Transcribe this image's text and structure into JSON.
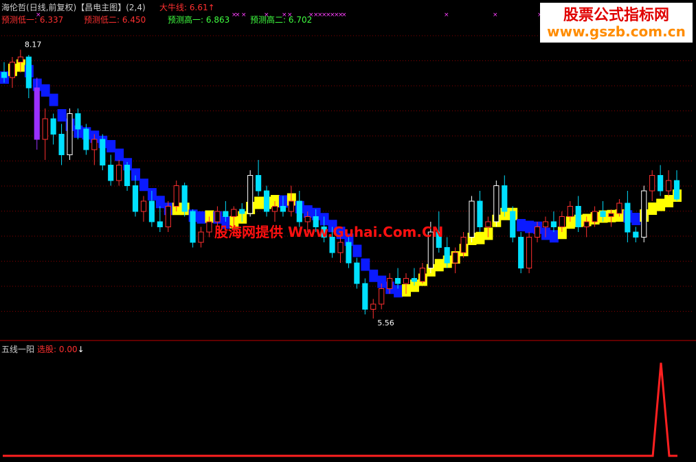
{
  "header": {
    "stock_name": "海伦哲",
    "period": "(日线,前复权)",
    "indicator": "【昌电主图】",
    "params": "(2,4)",
    "bull_line_label": "大牛线:",
    "bull_line_value": "6.61",
    "pred_low1_label": "预测低一:",
    "pred_low1_value": "6.337",
    "pred_low2_label": "预测低二:",
    "pred_low2_value": "6.450",
    "pred_high1_label": "预测高一:",
    "pred_high1_value": "6.863",
    "pred_high2_label": "预测高二:",
    "pred_high2_value": "6.702"
  },
  "watermark": {
    "line1": "股票公式指标网",
    "line2": "www.gszb.com.cn",
    "center": "股海网提供 Www.Guhai.Com.CN"
  },
  "sub_panel": {
    "name": "五线一阳",
    "select_label": "选股:",
    "select_value": "0.00"
  },
  "colors": {
    "up": "#ff3030",
    "down": "#00e0ff",
    "white": "#ffffff",
    "purple": "#9a30ff",
    "blue_band": "#0a1aff",
    "yellow_band": "#ffff00",
    "grid": "#8b0000",
    "signal_s": "#ffffff",
    "signal_b": "#ff3030",
    "magenta": "#ff40ff"
  },
  "chart_data": [
    {
      "type": "candlestick",
      "title": "海伦哲(日线,前复权)",
      "ylim": [
        5.4,
        8.4
      ],
      "annotations": [
        {
          "text": "8.17",
          "value": 8.17,
          "kind": "high"
        },
        {
          "text": "5.56",
          "value": 5.56,
          "kind": "low"
        }
      ],
      "candles": [
        [
          7.95,
          8.05,
          7.85,
          7.9
        ],
        [
          7.9,
          8.1,
          7.8,
          8.05
        ],
        [
          8.05,
          8.17,
          7.95,
          8.1
        ],
        [
          8.1,
          8.12,
          7.7,
          7.8
        ],
        [
          7.8,
          7.9,
          7.2,
          7.3
        ],
        [
          7.3,
          7.6,
          7.1,
          7.5
        ],
        [
          7.5,
          7.55,
          7.25,
          7.35
        ],
        [
          7.35,
          7.45,
          7.05,
          7.15
        ],
        [
          7.15,
          7.6,
          7.1,
          7.55
        ],
        [
          7.55,
          7.6,
          7.3,
          7.4
        ],
        [
          7.4,
          7.45,
          7.15,
          7.2
        ],
        [
          7.2,
          7.35,
          7.05,
          7.3
        ],
        [
          7.3,
          7.35,
          7.0,
          7.05
        ],
        [
          7.05,
          7.15,
          6.85,
          6.9
        ],
        [
          6.9,
          7.1,
          6.85,
          7.05
        ],
        [
          7.05,
          7.08,
          6.8,
          6.85
        ],
        [
          6.85,
          6.95,
          6.55,
          6.6
        ],
        [
          6.6,
          6.75,
          6.5,
          6.7
        ],
        [
          6.7,
          6.8,
          6.45,
          6.5
        ],
        [
          6.5,
          6.65,
          6.4,
          6.45
        ],
        [
          6.45,
          6.7,
          6.4,
          6.65
        ],
        [
          6.65,
          6.9,
          6.6,
          6.85
        ],
        [
          6.85,
          6.88,
          6.55,
          6.6
        ],
        [
          6.6,
          6.62,
          6.25,
          6.3
        ],
        [
          6.3,
          6.45,
          6.25,
          6.4
        ],
        [
          6.4,
          6.55,
          6.35,
          6.5
        ],
        [
          6.5,
          6.65,
          6.45,
          6.6
        ],
        [
          6.6,
          6.7,
          6.5,
          6.55
        ],
        [
          6.55,
          6.65,
          6.45,
          6.62
        ],
        [
          6.62,
          6.68,
          6.5,
          6.58
        ],
        [
          6.58,
          7.0,
          6.55,
          6.95
        ],
        [
          6.95,
          7.1,
          6.75,
          6.8
        ],
        [
          6.8,
          6.85,
          6.55,
          6.6
        ],
        [
          6.6,
          6.7,
          6.5,
          6.65
        ],
        [
          6.65,
          6.75,
          6.55,
          6.6
        ],
        [
          6.6,
          6.85,
          6.55,
          6.7
        ],
        [
          6.7,
          6.8,
          6.45,
          6.5
        ],
        [
          6.5,
          6.6,
          6.4,
          6.55
        ],
        [
          6.55,
          6.62,
          6.4,
          6.45
        ],
        [
          6.45,
          6.55,
          6.3,
          6.35
        ],
        [
          6.35,
          6.45,
          6.15,
          6.2
        ],
        [
          6.2,
          6.35,
          6.1,
          6.3
        ],
        [
          6.3,
          6.35,
          6.05,
          6.1
        ],
        [
          6.1,
          6.15,
          5.85,
          5.9
        ],
        [
          5.9,
          5.95,
          5.6,
          5.65
        ],
        [
          5.65,
          5.75,
          5.56,
          5.7
        ],
        [
          5.7,
          5.9,
          5.65,
          5.85
        ],
        [
          5.85,
          6.0,
          5.8,
          5.95
        ],
        [
          5.95,
          6.05,
          5.85,
          5.9
        ],
        [
          5.9,
          6.0,
          5.8,
          5.95
        ],
        [
          5.95,
          6.05,
          5.88,
          5.92
        ],
        [
          5.92,
          6.1,
          5.9,
          6.05
        ],
        [
          6.05,
          6.5,
          6.0,
          6.4
        ],
        [
          6.4,
          6.6,
          6.2,
          6.25
        ],
        [
          6.25,
          6.35,
          6.05,
          6.1
        ],
        [
          6.1,
          6.25,
          6.0,
          6.2
        ],
        [
          6.2,
          6.4,
          6.15,
          6.35
        ],
        [
          6.35,
          6.75,
          6.3,
          6.7
        ],
        [
          6.7,
          6.8,
          6.4,
          6.45
        ],
        [
          6.45,
          6.55,
          6.35,
          6.5
        ],
        [
          6.5,
          6.9,
          6.45,
          6.85
        ],
        [
          6.85,
          6.95,
          6.55,
          6.6
        ],
        [
          6.6,
          6.65,
          6.3,
          6.35
        ],
        [
          6.35,
          6.4,
          6.0,
          6.05
        ],
        [
          6.05,
          6.4,
          6.0,
          6.35
        ],
        [
          6.35,
          6.5,
          6.3,
          6.45
        ],
        [
          6.45,
          6.55,
          6.35,
          6.5
        ],
        [
          6.5,
          6.6,
          6.4,
          6.45
        ],
        [
          6.45,
          6.6,
          6.4,
          6.55
        ],
        [
          6.55,
          6.7,
          6.5,
          6.65
        ],
        [
          6.65,
          6.75,
          6.4,
          6.45
        ],
        [
          6.45,
          6.55,
          6.35,
          6.5
        ],
        [
          6.5,
          6.65,
          6.45,
          6.6
        ],
        [
          6.6,
          6.7,
          6.5,
          6.55
        ],
        [
          6.55,
          6.62,
          6.45,
          6.58
        ],
        [
          6.58,
          6.72,
          6.55,
          6.68
        ],
        [
          6.68,
          6.8,
          6.3,
          6.4
        ],
        [
          6.4,
          6.45,
          6.3,
          6.35
        ],
        [
          6.35,
          6.85,
          6.3,
          6.8
        ],
        [
          6.8,
          7.0,
          6.7,
          6.95
        ],
        [
          6.95,
          7.05,
          6.75,
          6.8
        ],
        [
          6.8,
          7.0,
          6.75,
          6.9
        ],
        [
          6.9,
          7.0,
          6.7,
          6.72
        ]
      ]
    },
    {
      "type": "line",
      "title": "五线一阳",
      "series": [
        {
          "name": "选股",
          "values": [
            0,
            0,
            0,
            0,
            0,
            0,
            0,
            0,
            0,
            0,
            0,
            0,
            0,
            0,
            0,
            0,
            0,
            0,
            0,
            0,
            0,
            0,
            0,
            0,
            0,
            0,
            0,
            0,
            0,
            0,
            0,
            0,
            0,
            0,
            0,
            0,
            0,
            0,
            0,
            0,
            0,
            0,
            0,
            0,
            0,
            0,
            0,
            0,
            0,
            0,
            0,
            0,
            0,
            0,
            0,
            0,
            0,
            0,
            0,
            0,
            0,
            0,
            0,
            0,
            0,
            0,
            0,
            0,
            0,
            0,
            0,
            0,
            0,
            0,
            0,
            0,
            0,
            0,
            0,
            0,
            1,
            0,
            0
          ]
        }
      ],
      "ylim": [
        0,
        1.1
      ]
    }
  ]
}
